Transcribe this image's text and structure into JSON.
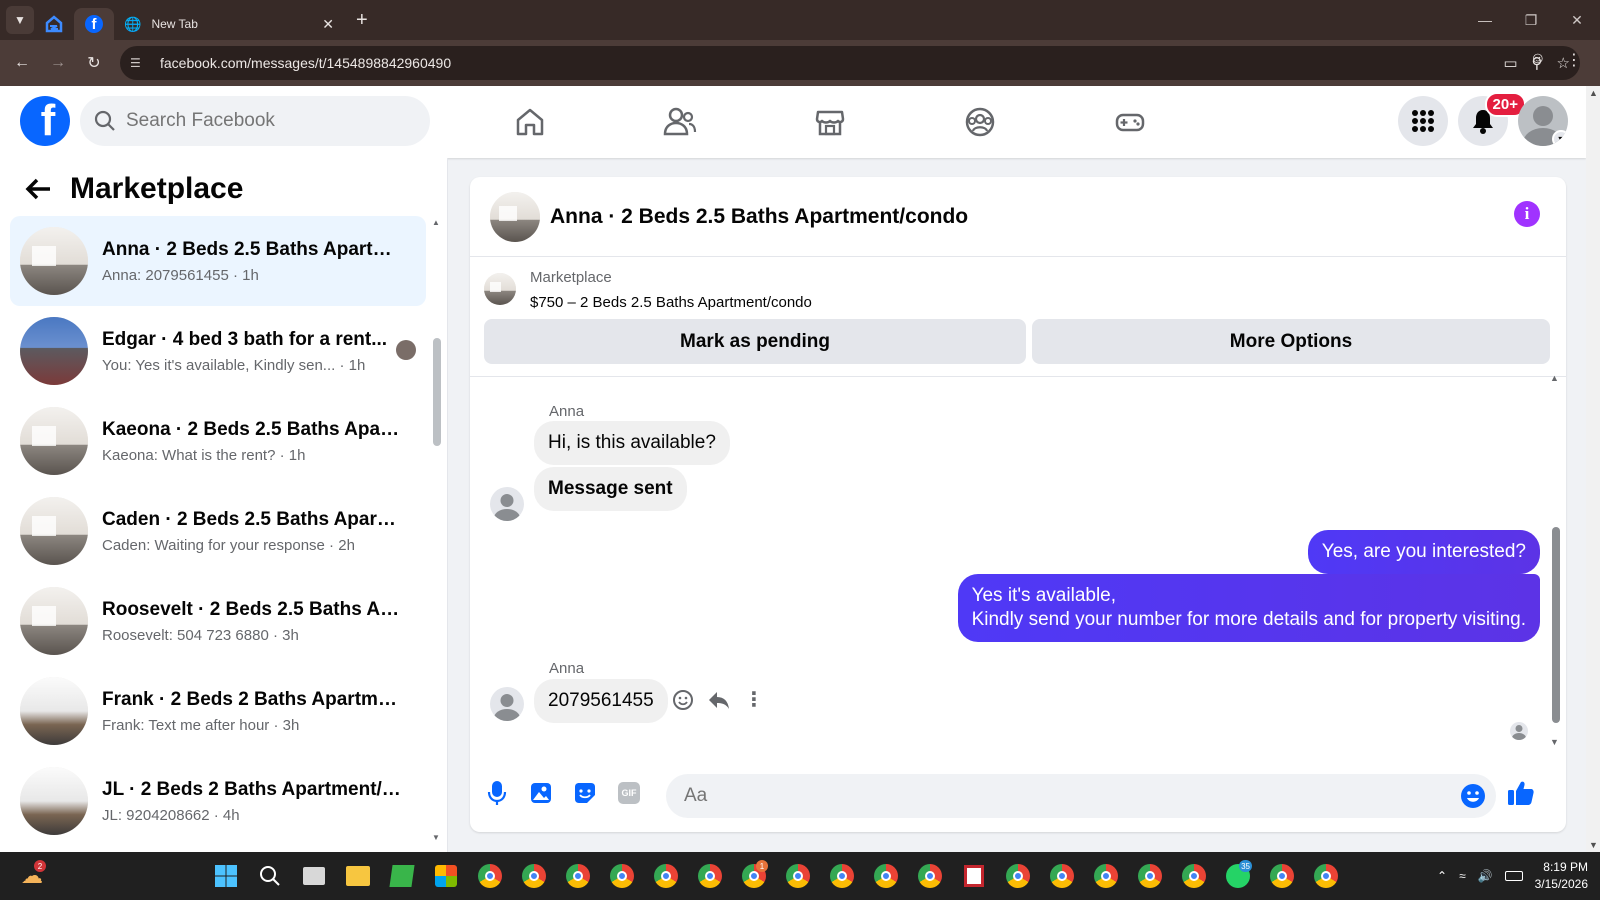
{
  "browser": {
    "tabs": [
      {
        "label": "",
        "icon": "facebook-icon"
      },
      {
        "label": "New Tab",
        "icon": "globe-icon"
      }
    ],
    "url": "facebook.com/messages/t/1454898842960490"
  },
  "fb": {
    "search_placeholder": "Search Facebook",
    "notifications_badge": "20+",
    "accent": "#0866ff"
  },
  "sidebar": {
    "title": "Marketplace",
    "conversations": [
      {
        "name": "Anna · 2 Beds 2.5 Baths Apartme...",
        "preview": "Anna: 2079561455 · 1h"
      },
      {
        "name": "Edgar · 4 bed 3 bath for a rent...",
        "preview": "You: Yes it's available, Kindly sen...  · 1h"
      },
      {
        "name": "Kaeona · 2 Beds 2.5 Baths Apart...",
        "preview": "Kaeona: What is the rent? · 1h"
      },
      {
        "name": "Caden · 2 Beds 2.5 Baths Apartm...",
        "preview": "Caden: Waiting for your response · 2h"
      },
      {
        "name": "Roosevelt · 2 Beds 2.5 Baths Apa...",
        "preview": "Roosevelt: 504 723 6880 · 3h"
      },
      {
        "name": "Frank · 2 Beds 2 Baths Apartmen...",
        "preview": "Frank: Text me after hour · 3h"
      },
      {
        "name": "JL · 2 Beds 2 Baths Apartment/c...",
        "preview": "JL: 9204208662 · 4h"
      }
    ]
  },
  "chat": {
    "title": "Anna · 2 Beds 2.5 Baths Apartment/condo",
    "listing_label": "Marketplace",
    "listing_price": "$750 – 2 Beds 2.5 Baths Apartment/condo",
    "mark_pending": "Mark as pending",
    "more_options": "More Options",
    "messages": {
      "sender1": "Anna",
      "m1": "Hi, is this available?",
      "m2": "Message sent",
      "m3": "Yes, are you interested?",
      "m4_line1": "Yes it's available,",
      "m4_line2": "Kindly send your number for more details and for property visiting.",
      "sender2": "Anna",
      "m5": "2079561455"
    },
    "composer_placeholder": "Aa",
    "my_bubble_color": "#5b3cf0"
  },
  "taskbar": {
    "weather_badge": "2",
    "whatsapp_badge": "35",
    "chrome_badge": "1",
    "time": "8:19 PM",
    "date": "3/15/2026"
  }
}
